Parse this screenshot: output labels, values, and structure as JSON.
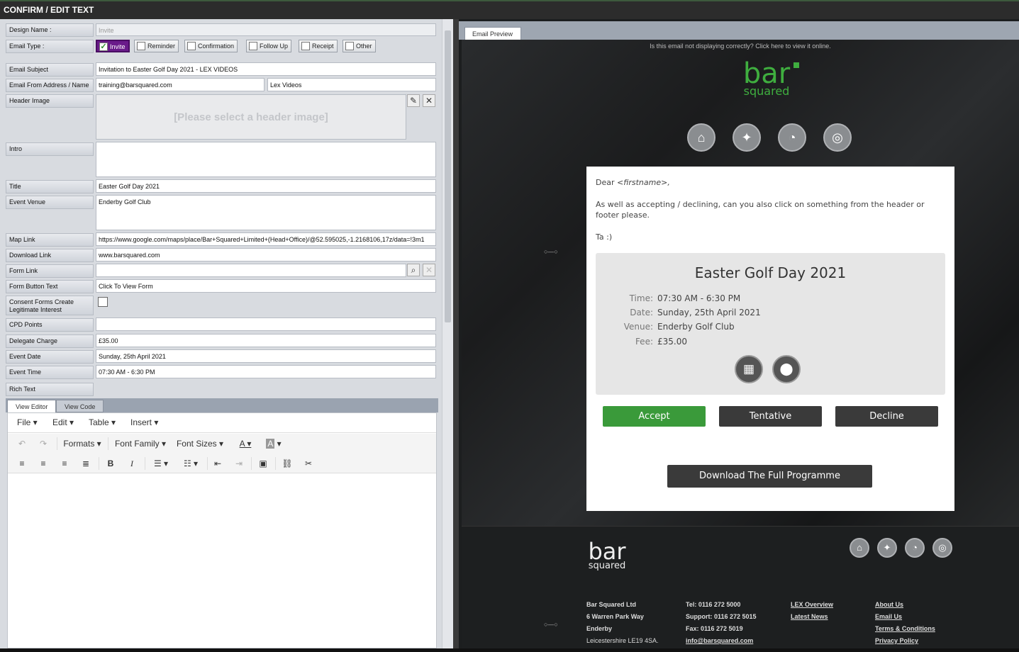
{
  "window": {
    "title": "CONFIRM / EDIT TEXT"
  },
  "form": {
    "design_name": {
      "label": "Design Name :",
      "value": "Invite"
    },
    "email_type": {
      "label": "Email Type :",
      "options": [
        "Invite",
        "Reminder",
        "Confirmation",
        "Follow Up",
        "Receipt",
        "Other"
      ],
      "selected": "Invite"
    },
    "email_subject": {
      "label": "Email Subject",
      "value": "Invitation to Easter Golf Day 2021 - LEX VIDEOS"
    },
    "email_from": {
      "label": "Email From Address / Name",
      "address": "training@barsquared.com",
      "name": "Lex Videos"
    },
    "header_image": {
      "label": "Header Image",
      "placeholder": "[Please select a header image]"
    },
    "intro": {
      "label": "Intro",
      "value": ""
    },
    "title": {
      "label": "Title",
      "value": "Easter Golf Day 2021"
    },
    "event_venue": {
      "label": "Event Venue",
      "value": "Enderby Golf Club"
    },
    "map_link": {
      "label": "Map Link",
      "value": "https://www.google.com/maps/place/Bar+Squared+Limited+(Head+Office)/@52.595025,-1.2168106,17z/data=!3m1"
    },
    "download_link": {
      "label": "Download Link",
      "value": "www.barsquared.com"
    },
    "form_link": {
      "label": "Form Link",
      "value": ""
    },
    "form_button_text": {
      "label": "Form Button Text",
      "value": "Click To View Form"
    },
    "consent": {
      "label": "Consent Forms Create Legitimate Interest"
    },
    "cpd_points": {
      "label": "CPD Points",
      "value": ""
    },
    "delegate_charge": {
      "label": "Delegate Charge",
      "value": "£35.00"
    },
    "event_date": {
      "label": "Event Date",
      "value": "Sunday, 25th April 2021"
    },
    "event_time": {
      "label": "Event Time",
      "value": "07:30 AM - 6:30 PM"
    },
    "rich_text": {
      "label": "Rich Text"
    }
  },
  "editor": {
    "tabs": [
      "View Editor",
      "View Code"
    ],
    "menus": [
      "File",
      "Edit",
      "Table",
      "Insert"
    ],
    "toolbar": {
      "formats": "Formats",
      "font_family": "Font Family",
      "font_sizes": "Font Sizes",
      "text_color": "A",
      "bg_color": "A",
      "bold": "B",
      "italic": "I"
    }
  },
  "preview": {
    "tab": "Email Preview",
    "notice": "Is this email not displaying correctly?",
    "notice_link": "Click here to view it online",
    "logo_main": "bar",
    "logo_sub": "squared",
    "greeting": "Dear",
    "greeting_name": "<firstname>,",
    "body": "As well as accepting / declining, can you also click on something from the header or footer please.",
    "signoff": "Ta :)",
    "event_title": "Easter Golf Day 2021",
    "rows": [
      {
        "k": "Time:",
        "v": "07:30 AM - 6:30 PM"
      },
      {
        "k": "Date:",
        "v": "Sunday, 25th April 2021"
      },
      {
        "k": "Venue:",
        "v": "Enderby Golf Club"
      },
      {
        "k": "Fee:",
        "v": "£35.00"
      }
    ],
    "buttons": {
      "accept": "Accept",
      "tentative": "Tentative",
      "decline": "Decline"
    },
    "download": "Download The Full Programme",
    "footer": {
      "address": [
        "Bar Squared Ltd",
        "6 Warren Park Way",
        "Enderby",
        "Leicestershire LE19 4SA."
      ],
      "contact": [
        "Tel: 0116 272 5000",
        "Support: 0116 272 5015",
        "Fax: 0116 272 5019",
        "info@barsquared.com"
      ],
      "links1": [
        "LEX Overview",
        "Latest News"
      ],
      "links2": [
        "About Us",
        "Email Us",
        "Terms & Conditions",
        "Privacy Policy"
      ]
    }
  },
  "colors": {
    "accent_purple": "#6a1b8a",
    "accept_green": "#3a9a3a",
    "logo_green": "#3fae3f"
  }
}
